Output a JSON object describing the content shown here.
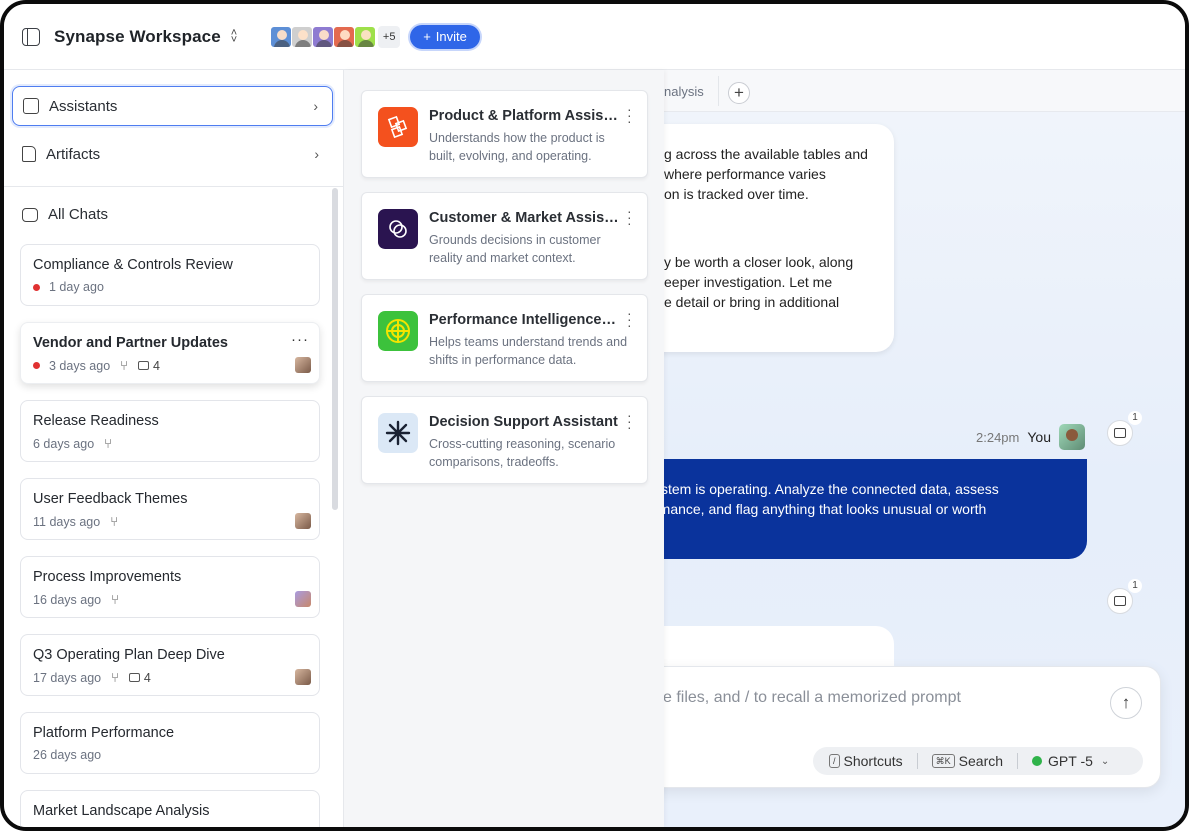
{
  "header": {
    "title": "Synapse Workspace",
    "more_count": "+5",
    "invite_label": "Invite",
    "invite_plus": "+"
  },
  "colors": {
    "accent": "#2f66e8",
    "user_bubble": "#0a339c",
    "status_red": "#e03131",
    "model_green": "#2fb34a"
  },
  "sidebar": {
    "assistants_label": "Assistants",
    "artifacts_label": "Artifacts",
    "all_chats_label": "All Chats",
    "chats": [
      {
        "title": "Compliance & Controls Review",
        "time": "1 day ago",
        "unread": true
      },
      {
        "title": "Vendor and Partner Updates",
        "time": "3 days ago",
        "unread": true,
        "comments": "4"
      },
      {
        "title": "Release Readiness",
        "time": "6 days ago"
      },
      {
        "title": "User Feedback Themes",
        "time": "11 days ago"
      },
      {
        "title": "Process Improvements",
        "time": "16 days ago"
      },
      {
        "title": "Q3 Operating Plan Deep Dive",
        "time": "17 days ago",
        "comments": "4"
      },
      {
        "title": "Platform Performance",
        "time": "26 days ago"
      },
      {
        "title": "Market Landscape Analysis",
        "time": ""
      }
    ]
  },
  "assistants": [
    {
      "name": "Product & Platform Assist…",
      "desc1": "Understands how the product is",
      "desc2": "built, evolving, and operating.",
      "icon": "cubes-icon",
      "color": "#f4511e"
    },
    {
      "name": "Customer & Market Assist…",
      "desc1": "Grounds decisions in customer",
      "desc2": "reality and market context.",
      "icon": "rings-icon",
      "color": "#2a1450"
    },
    {
      "name": "Performance Intelligence…",
      "desc1": "Helps teams understand trends and",
      "desc2": "shifts in performance data.",
      "icon": "radar-icon",
      "color": "#3cc23c"
    },
    {
      "name": "Decision Support Assistant",
      "desc1": "Cross-cutting reasoning, scenario",
      "desc2": "comparisons, tradeoffs.",
      "icon": "asterisk-icon",
      "color": "#dbe8f6"
    }
  ],
  "chat": {
    "tab_fragment": "nalysis",
    "ai_lines_1": [
      "g across the available tables and",
      " where performance varies",
      "on is tracked over time."
    ],
    "ai_lines_2": [
      "y be worth a closer look, along",
      "eeper investigation. Let me",
      "e detail or bring in additional"
    ],
    "user_time": "2:24pm",
    "user_name": "You",
    "user_lines": [
      "ystem is operating. Analyze the connected data, assess",
      "rmance, and flag anything that looks unusual or worth"
    ],
    "comment_badge_1": "1",
    "comment_badge_2": "1",
    "composer_placeholder": "e files, and / to recall a memorized prompt",
    "shortcuts_label": "Shortcuts",
    "shortcuts_key": "/",
    "search_label": "Search",
    "search_key": "⌘K",
    "model_label": "GPT -5"
  }
}
